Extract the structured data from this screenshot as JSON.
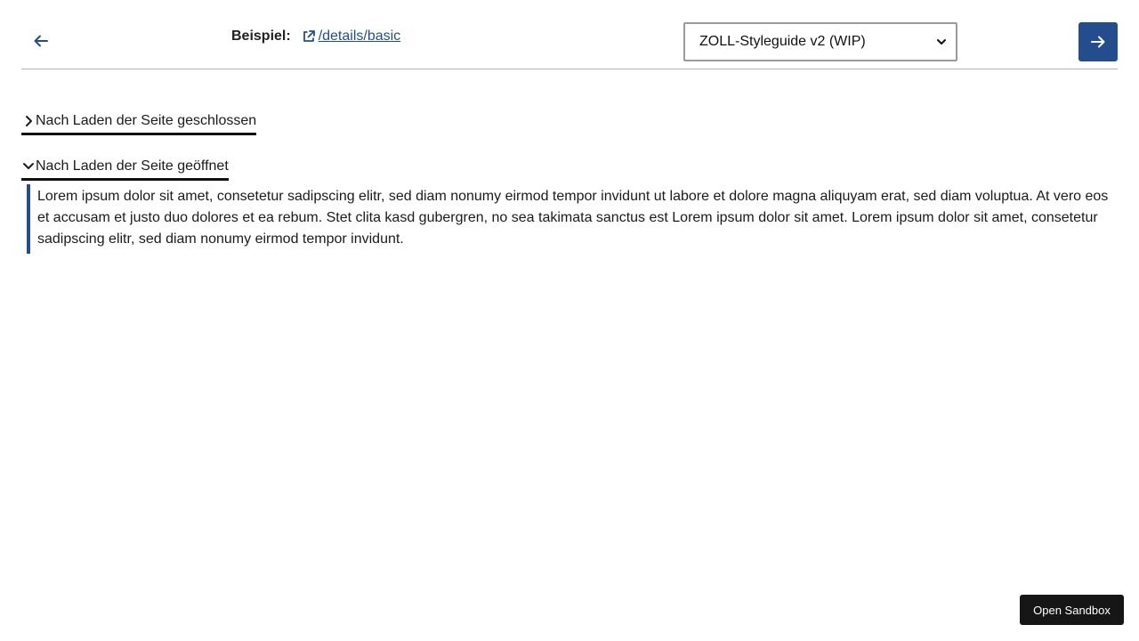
{
  "header": {
    "back_icon": "arrow-left-icon",
    "example_label": "Beispiel:",
    "example_link_icon": "external-link-icon",
    "example_link_text": "/details/basic",
    "styleguide_select": {
      "selected": "ZOLL-Styleguide v2 (WIP)"
    },
    "next_icon": "arrow-right-icon"
  },
  "details": [
    {
      "summary": "Nach Laden der Seite geschlossen",
      "open": false
    },
    {
      "summary": "Nach Laden der Seite geöffnet",
      "open": true,
      "content": "Lorem ipsum dolor sit amet, consetetur sadipscing elitr, sed diam nonumy eirmod tempor invidunt ut labore et dolore magna aliquyam erat, sed diam voluptua. At vero eos et accusam et justo duo dolores et ea rebum. Stet clita kasd gubergren, no sea takimata sanctus est Lorem ipsum dolor sit amet. Lorem ipsum dolor sit amet, consetetur sadipscing elitr, sed diam nonumy eirmod tempor invidunt."
    }
  ],
  "sandbox_button": "Open Sandbox",
  "colors": {
    "accent": "#234d8c",
    "link": "#1f4f92",
    "sandbox_bg": "#161616"
  }
}
